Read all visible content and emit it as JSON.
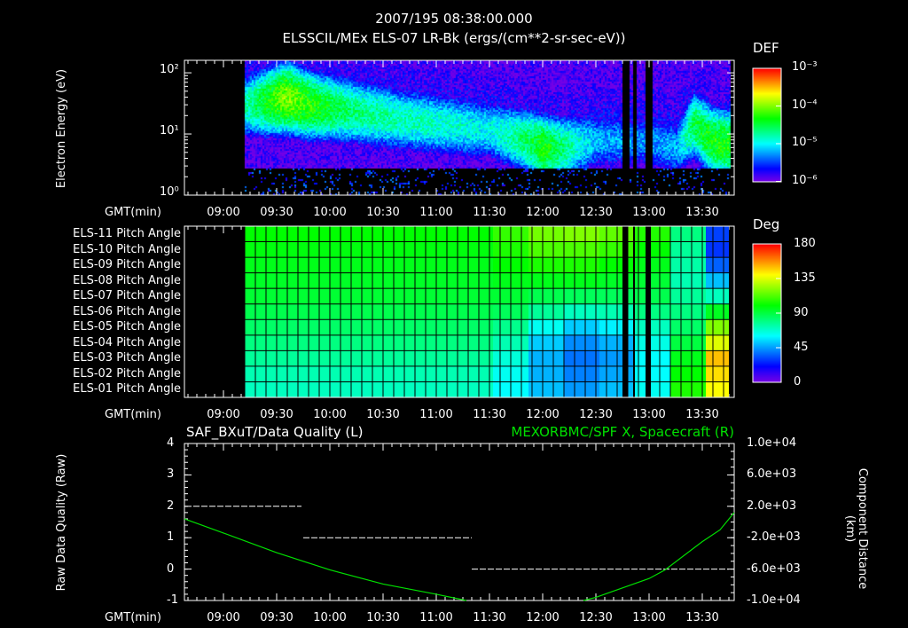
{
  "header": {
    "title": "2007/195 08:38:00.000"
  },
  "chart_data": [
    {
      "type": "heatmap",
      "title": "ELSSCIL/MEx ELS-07 LR-Bk  (ergs/(cm**2-sr-sec-eV))",
      "ylabel": "Electron Energy (eV)",
      "xlabel": "GMT(min)",
      "xlim": [
        "08:38",
        "13:48"
      ],
      "ylim": [
        1,
        160
      ],
      "yscale": "log",
      "yticks": [
        "10⁰",
        "10¹",
        "10²"
      ],
      "xticks": [
        "09:00",
        "09:30",
        "10:00",
        "10:30",
        "11:00",
        "11:30",
        "12:00",
        "12:30",
        "13:00",
        "13:30"
      ],
      "data_start": "09:12",
      "data_end": "13:45",
      "colorbar": {
        "label": "DEF",
        "ticks": [
          "10⁻³",
          "10⁻⁴",
          "10⁻⁵",
          "10⁻⁶"
        ],
        "log_range": [
          -6,
          -3
        ]
      },
      "ridge": [
        {
          "t": "09:12",
          "e": 30,
          "v": -4.8
        },
        {
          "t": "09:25",
          "e": 35,
          "v": -4.3
        },
        {
          "t": "09:35",
          "e": 40,
          "v": -4.0
        },
        {
          "t": "09:50",
          "e": 30,
          "v": -4.3
        },
        {
          "t": "10:10",
          "e": 25,
          "v": -4.6
        },
        {
          "t": "10:40",
          "e": 18,
          "v": -4.8
        },
        {
          "t": "11:10",
          "e": 14,
          "v": -4.9
        },
        {
          "t": "11:30",
          "e": 12,
          "v": -5.0
        },
        {
          "t": "11:50",
          "e": 8,
          "v": -4.6
        },
        {
          "t": "12:00",
          "e": 6,
          "v": -4.3
        },
        {
          "t": "12:10",
          "e": 6,
          "v": -4.6
        },
        {
          "t": "12:30",
          "e": 8,
          "v": -5.2
        },
        {
          "t": "13:00",
          "e": 8,
          "v": -5.3
        },
        {
          "t": "13:15",
          "e": 6,
          "v": -5.2
        },
        {
          "t": "13:25",
          "e": 15,
          "v": -4.5
        },
        {
          "t": "13:35",
          "e": 8,
          "v": -4.3
        },
        {
          "t": "13:45",
          "e": 7,
          "v": -4.3
        }
      ],
      "gaps": [
        [
          "12:45",
          "12:48"
        ],
        [
          "12:51",
          "12:52"
        ],
        [
          "12:58",
          "13:01"
        ]
      ]
    },
    {
      "type": "heatmap",
      "title": "Pitch Angle",
      "xlabel": "GMT(min)",
      "rows": [
        "ELS-11 Pitch Angle",
        "ELS-10 Pitch Angle",
        "ELS-09 Pitch Angle",
        "ELS-08 Pitch Angle",
        "ELS-07 Pitch Angle",
        "ELS-06 Pitch Angle",
        "ELS-05 Pitch Angle",
        "ELS-04 Pitch Angle",
        "ELS-03 Pitch Angle",
        "ELS-02 Pitch Angle",
        "ELS-01 Pitch Angle"
      ],
      "xticks": [
        "09:00",
        "09:30",
        "10:00",
        "10:30",
        "11:00",
        "11:30",
        "12:00",
        "12:30",
        "13:00",
        "13:30"
      ],
      "colorbar": {
        "label": "Deg",
        "ticks": [
          "180",
          "135",
          "90",
          "45",
          "0"
        ],
        "range": [
          0,
          180
        ]
      },
      "columns": [
        "09:12",
        "09:32",
        "09:52",
        "10:12",
        "10:32",
        "10:52",
        "11:12",
        "11:32",
        "11:52",
        "12:12",
        "12:32",
        "12:52",
        "13:12",
        "13:32"
      ],
      "values": [
        [
          100,
          98,
          96,
          94,
          92,
          88,
          84,
          80,
          76,
          72,
          70
        ],
        [
          100,
          98,
          96,
          94,
          92,
          88,
          84,
          80,
          76,
          72,
          70
        ],
        [
          100,
          98,
          96,
          94,
          92,
          88,
          84,
          80,
          76,
          72,
          70
        ],
        [
          100,
          98,
          96,
          94,
          92,
          88,
          84,
          80,
          76,
          72,
          70
        ],
        [
          100,
          98,
          96,
          94,
          92,
          88,
          84,
          80,
          76,
          72,
          70
        ],
        [
          100,
          98,
          96,
          94,
          92,
          88,
          84,
          80,
          76,
          72,
          70
        ],
        [
          100,
          98,
          96,
          94,
          92,
          88,
          84,
          80,
          76,
          72,
          70
        ],
        [
          108,
          104,
          100,
          96,
          92,
          86,
          78,
          72,
          66,
          62,
          60
        ],
        [
          118,
          112,
          104,
          96,
          88,
          76,
          62,
          52,
          48,
          48,
          50
        ],
        [
          120,
          112,
          104,
          96,
          86,
          70,
          52,
          42,
          38,
          40,
          44
        ],
        [
          115,
          108,
          100,
          94,
          86,
          72,
          58,
          48,
          44,
          46,
          50
        ],
        [
          105,
          100,
          96,
          92,
          88,
          80,
          70,
          64,
          60,
          60,
          62
        ],
        [
          80,
          76,
          74,
          72,
          76,
          80,
          84,
          90,
          96,
          100,
          104
        ],
        [
          30,
          28,
          35,
          50,
          70,
          95,
          120,
          135,
          150,
          145,
          140
        ]
      ],
      "data_end": "13:45",
      "gaps": [
        [
          "12:45",
          "12:48"
        ],
        [
          "12:51",
          "12:52"
        ],
        [
          "12:58",
          "13:01"
        ]
      ]
    },
    {
      "type": "line",
      "title_left": "SAF_BXuT/Data Quality (L)",
      "title_right": "MEXORBMC/SPF X, Spacecraft (R)",
      "ylabel_left": "Raw Data Quality (Raw)",
      "ylabel_right": "Component Distance (km)",
      "xlabel": "GMT(min)",
      "ylim_left": [
        -1,
        4
      ],
      "yticks_left": [
        "4",
        "3",
        "2",
        "1",
        "0",
        "-1"
      ],
      "ylim_right": [
        -10000,
        10000
      ],
      "yticks_right": [
        "1.0e+04",
        "6.0e+03",
        "2.0e+03",
        "-2.0e+03",
        "-6.0e+03",
        "-1.0e+04"
      ],
      "xticks": [
        "09:00",
        "09:30",
        "10:00",
        "10:30",
        "11:00",
        "11:30",
        "12:00",
        "12:30",
        "13:00",
        "13:30"
      ],
      "series": [
        {
          "name": "Data Quality",
          "axis": "left",
          "color": "#ffffff",
          "style": "dashed-steps",
          "segments": [
            {
              "from": "08:43",
              "to": "09:44",
              "y": 2
            },
            {
              "from": "09:45",
              "to": "11:20",
              "y": 1
            },
            {
              "from": "11:20",
              "to": "13:45",
              "y": 0
            }
          ]
        },
        {
          "name": "SPF X",
          "axis": "right",
          "color": "#00e000",
          "points": [
            [
              "08:38",
              400
            ],
            [
              "09:00",
              -1400
            ],
            [
              "09:30",
              -3900
            ],
            [
              "10:00",
              -6100
            ],
            [
              "10:30",
              -7900
            ],
            [
              "11:00",
              -9200
            ],
            [
              "11:17",
              -10000
            ],
            [
              "12:23",
              -10000
            ],
            [
              "12:30",
              -9600
            ],
            [
              "13:00",
              -7200
            ],
            [
              "13:09",
              -6100
            ],
            [
              "13:30",
              -2500
            ],
            [
              "13:40",
              -1000
            ],
            [
              "13:48",
              1200
            ]
          ]
        }
      ]
    }
  ]
}
